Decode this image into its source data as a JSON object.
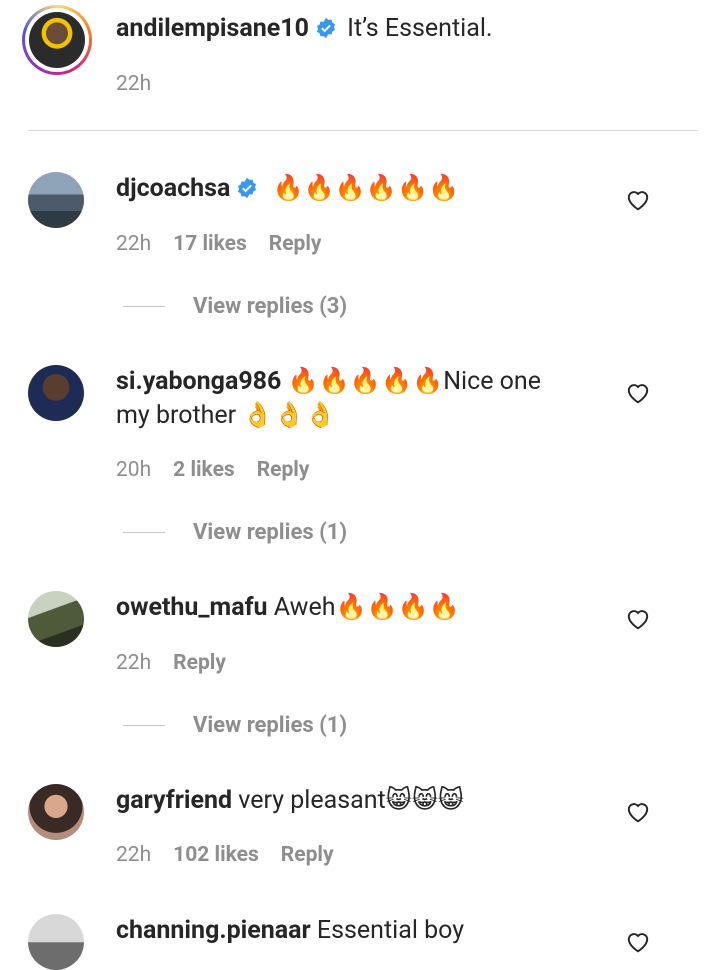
{
  "caption": {
    "username": "andilempisane10",
    "text": "It’s Essential.",
    "time": "22h"
  },
  "comments": [
    {
      "username": "djcoachsa",
      "verified": true,
      "text": "🔥🔥🔥🔥🔥🔥",
      "time": "22h",
      "likes": "17 likes",
      "reply": "Reply",
      "replies": "View replies (3)"
    },
    {
      "username": "si.yabonga986",
      "verified": false,
      "text_line1": "🔥🔥🔥🔥🔥Nice one",
      "text_line2": "my brother 👌👌👌",
      "time": "20h",
      "likes": "2 likes",
      "reply": "Reply",
      "replies": "View replies (1)"
    },
    {
      "username": "owethu_mafu",
      "verified": false,
      "text": "Aweh🔥🔥🔥🔥",
      "time": "22h",
      "reply": "Reply",
      "replies": "View replies (1)"
    },
    {
      "username": "garyfriend",
      "verified": false,
      "text": "very pleasant😸😸😸",
      "time": "22h",
      "likes": "102 likes",
      "reply": "Reply"
    },
    {
      "username": "channing.pienaar",
      "verified": false,
      "text": "Essential boy"
    }
  ],
  "colors": {
    "text": "#262626",
    "secondary": "#8e8e8e",
    "verified": "#3897f0",
    "divider": "#dbdbdb"
  }
}
